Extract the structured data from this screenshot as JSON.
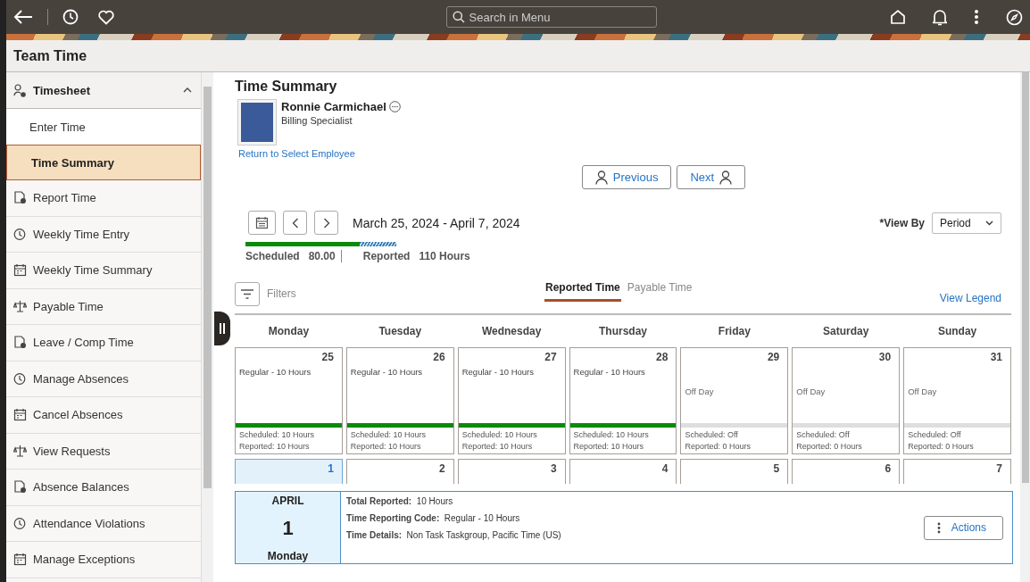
{
  "top_bar": {
    "search": {
      "placeholder": "Search in Menu"
    }
  },
  "page_title": "Team Time",
  "sidebar": {
    "items": [
      {
        "label": "Timesheet",
        "expanded": true,
        "children": [
          {
            "label": "Enter Time",
            "selected": false
          },
          {
            "label": "Time Summary",
            "selected": true
          }
        ]
      },
      {
        "label": "Report Time",
        "selected": false
      },
      {
        "label": "Weekly Time Entry",
        "selected": false
      },
      {
        "label": "Weekly Time Summary",
        "selected": false
      },
      {
        "label": "Payable Time",
        "selected": false
      },
      {
        "label": "Leave / Comp Time",
        "selected": false
      },
      {
        "label": "Manage Absences",
        "selected": false
      },
      {
        "label": "Cancel Absences",
        "selected": false
      },
      {
        "label": "View Requests",
        "selected": false
      },
      {
        "label": "Absence Balances",
        "selected": false
      },
      {
        "label": "Attendance Violations",
        "selected": false
      },
      {
        "label": "Manage Exceptions",
        "selected": false
      }
    ]
  },
  "main": {
    "title": "Time Summary",
    "employee": {
      "name": "Ronnie Carmichael",
      "job": "Billing Specialist",
      "return_link": "Return to Select Employee"
    },
    "nav_buttons": [
      "Previous",
      "Next"
    ],
    "period": "March 25, 2024 - April 7, 2024",
    "view_by": {
      "label": "*View By",
      "value": "Period"
    },
    "progress": {
      "level": 0.76
    },
    "totals": [
      {
        "label": "Scheduled",
        "value": "80.00"
      },
      {
        "label": "Reported",
        "value": "110 Hours"
      }
    ],
    "filters": "Filters",
    "tabs": [
      {
        "label": "Reported Time",
        "selected": true
      },
      {
        "label": "Payable Time",
        "selected": false
      }
    ],
    "legend_link": "View Legend",
    "weekdays": [
      "Monday",
      "Tuesday",
      "Wednesday",
      "Thursday",
      "Friday",
      "Saturday",
      "Sunday"
    ],
    "weeks": [
      [
        {
          "day": "25",
          "kind": "work",
          "entry": "Regular - 10 Hours",
          "scheduled": "Scheduled: 10 Hours",
          "reported": "Reported: 10 Hours",
          "selected": false
        },
        {
          "day": "26",
          "kind": "work",
          "entry": "Regular - 10 Hours",
          "scheduled": "Scheduled: 10 Hours",
          "reported": "Reported: 10 Hours",
          "selected": false
        },
        {
          "day": "27",
          "kind": "work",
          "entry": "Regular - 10 Hours",
          "scheduled": "Scheduled: 10 Hours",
          "reported": "Reported: 10 Hours",
          "selected": false
        },
        {
          "day": "28",
          "kind": "work",
          "entry": "Regular - 10 Hours",
          "scheduled": "Scheduled: 10 Hours",
          "reported": "Reported: 10 Hours",
          "selected": false
        },
        {
          "day": "29",
          "kind": "off",
          "entry": "Off Day",
          "scheduled": "Scheduled: Off",
          "reported": "Reported: 0 Hours",
          "selected": false
        },
        {
          "day": "30",
          "kind": "off",
          "entry": "Off Day",
          "scheduled": "Scheduled: Off",
          "reported": "Reported: 0 Hours",
          "selected": false
        },
        {
          "day": "31",
          "kind": "off",
          "entry": "Off Day",
          "scheduled": "Scheduled: Off",
          "reported": "Reported: 0 Hours",
          "selected": false
        }
      ],
      [
        {
          "day": "1",
          "selected": true
        },
        {
          "day": "2",
          "selected": false
        },
        {
          "day": "3",
          "selected": false
        },
        {
          "day": "4",
          "selected": false
        },
        {
          "day": "5",
          "selected": false
        },
        {
          "day": "6",
          "selected": false
        },
        {
          "day": "7",
          "selected": false
        }
      ]
    ],
    "detail": {
      "month": "APRIL",
      "day": "1",
      "weekday": "Monday",
      "fields": [
        {
          "label": "Total Reported:",
          "value": "10 Hours"
        },
        {
          "label": "Time Reporting Code:",
          "value": "Regular - 10 Hours"
        },
        {
          "label": "Time Details:",
          "value": "Non Task Taskgroup, Pacific Time (US)"
        }
      ],
      "action": "Actions"
    }
  }
}
